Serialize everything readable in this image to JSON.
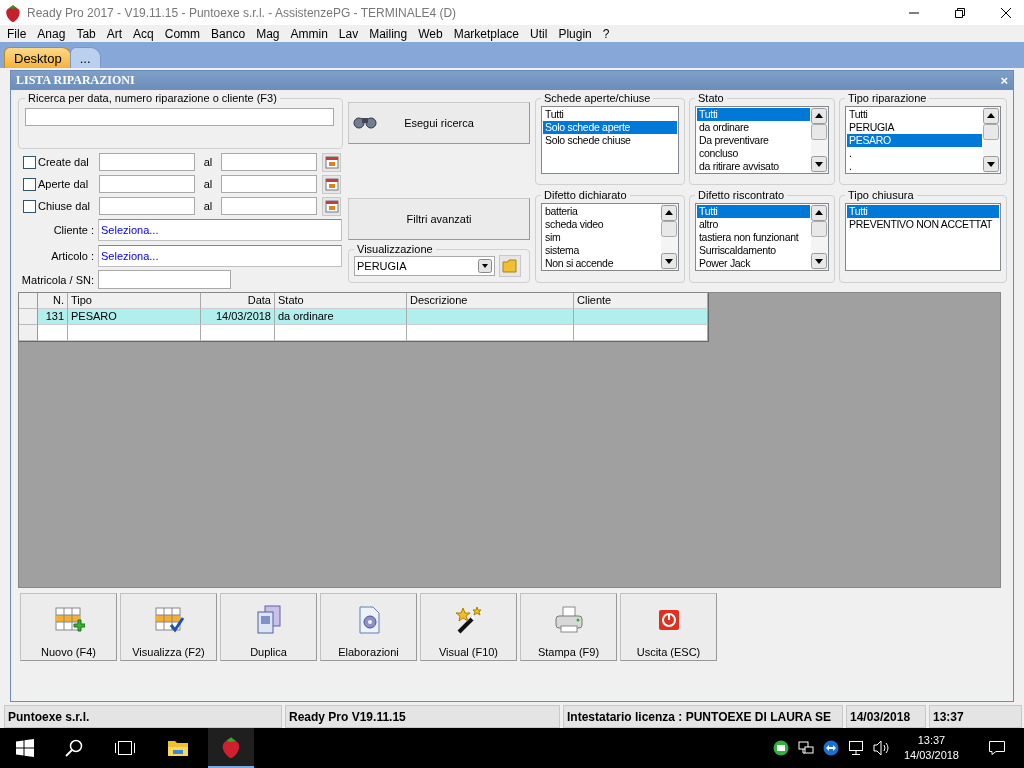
{
  "window": {
    "title": "Ready Pro 2017 - V19.11.15 - Puntoexe s.r.l. - AssistenzePG - TERMINALE4 (D)"
  },
  "menu": [
    "File",
    "Anag",
    "Tab",
    "Art",
    "Acq",
    "Comm",
    "Banco",
    "Mag",
    "Ammin",
    "Lav",
    "Mailing",
    "Web",
    "Marketplace",
    "Util",
    "Plugin",
    "?"
  ],
  "tabs": [
    {
      "label": "Desktop",
      "selected": true
    },
    {
      "label": "...",
      "selected": false
    }
  ],
  "panel": {
    "title": "LISTA RIPARAZIONI",
    "close": "×"
  },
  "search": {
    "legend": "Ricerca per data, numero riparazione o cliente (F3)"
  },
  "date_filters": [
    {
      "label": "Create dal",
      "to": "al",
      "checked": false
    },
    {
      "label": "Aperte dal",
      "to": "al",
      "checked": false
    },
    {
      "label": "Chiuse dal",
      "to": "al",
      "checked": false
    }
  ],
  "fields": [
    {
      "label": "Cliente :",
      "value": "Seleziona..."
    },
    {
      "label": "Articolo :",
      "value": "Seleziona..."
    },
    {
      "label": "Matricola / SN:"
    }
  ],
  "search_button": "Esegui ricerca",
  "advanced_button": "Filtri avanzati",
  "view": {
    "legend": "Visualizzazione",
    "value": "PERUGIA"
  },
  "lists": [
    {
      "legend": "Schede aperte/chiuse",
      "scrollable": false,
      "items": [
        {
          "label": "Tutti",
          "selected": false
        },
        {
          "label": "Solo schede aperte",
          "selected": true
        },
        {
          "label": "Solo schede chiuse",
          "selected": false
        }
      ]
    },
    {
      "legend": "Stato",
      "scrollable": true,
      "items": [
        {
          "label": "Tutti",
          "selected": true
        },
        {
          "label": "da ordinare",
          "selected": false
        },
        {
          "label": "Da preventivare",
          "selected": false
        },
        {
          "label": "concluso",
          "selected": false
        },
        {
          "label": "da ritirare avvisato",
          "selected": false
        }
      ]
    },
    {
      "legend": "Tipo riparazione",
      "scrollable": true,
      "items": [
        {
          "label": "Tutti",
          "selected": false
        },
        {
          "label": "PERUGIA",
          "selected": false
        },
        {
          "label": "PESARO",
          "selected": true
        },
        {
          "label": ".",
          "selected": false
        },
        {
          "label": ".",
          "selected": false
        }
      ]
    },
    {
      "legend": "Difetto dichiarato",
      "scrollable": true,
      "items": [
        {
          "label": "batteria",
          "selected": false
        },
        {
          "label": "scheda video",
          "selected": false
        },
        {
          "label": "sim",
          "selected": false
        },
        {
          "label": "sistema",
          "selected": false
        },
        {
          "label": "Non si accende",
          "selected": false
        }
      ]
    },
    {
      "legend": "Difetto riscontrato",
      "scrollable": true,
      "items": [
        {
          "label": "Tutti",
          "selected": true
        },
        {
          "label": "altro",
          "selected": false
        },
        {
          "label": "tastiera non funzionant",
          "selected": false
        },
        {
          "label": "Surriscaldamento",
          "selected": false
        },
        {
          "label": "Power Jack",
          "selected": false
        }
      ]
    },
    {
      "legend": "Tipo chiusura",
      "scrollable": false,
      "items": [
        {
          "label": "Tutti",
          "selected": true
        },
        {
          "label": "PREVENTIVO NON ACCETTAT",
          "selected": false
        }
      ]
    }
  ],
  "table": {
    "columns": [
      "N.",
      "Tipo",
      "Data",
      "Stato",
      "Descrizione",
      "Cliente"
    ],
    "rows": [
      {
        "cells": [
          "131",
          "PESARO",
          "14/03/2018",
          "da ordinare"
        ],
        "selected": true
      }
    ]
  },
  "actions": [
    "Nuovo (F4)",
    "Visualizza (F2)",
    "Duplica",
    "Elaborazioni",
    "Visual (F10)",
    "Stampa (F9)",
    "Uscita (ESC)"
  ],
  "status_bar": [
    "Puntoexe s.r.l.",
    "Ready Pro V19.11.15",
    "Intestatario licenza : PUNTOEXE DI LAURA SE",
    "14/03/2018",
    "13:37"
  ],
  "taskbar": {
    "time": "13:37",
    "date": "14/03/2018"
  }
}
